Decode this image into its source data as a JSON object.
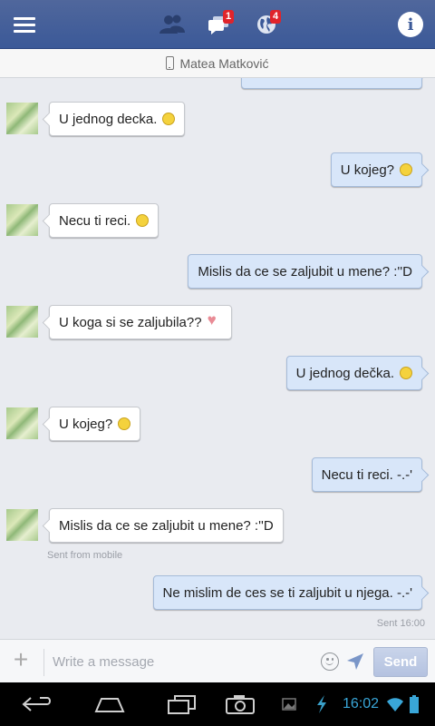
{
  "header": {
    "messages_badge": "1",
    "notifications_badge": "4"
  },
  "contact": {
    "name": "Matea Matković"
  },
  "conversation": [
    {
      "side": "in",
      "text": "U jednog decka.",
      "emoji": "smile"
    },
    {
      "side": "out",
      "text": "U kojeg?",
      "emoji": "grin"
    },
    {
      "side": "in",
      "text": "Necu ti reci.",
      "emoji": "unamused"
    },
    {
      "side": "out",
      "text": "Mislis da ce se zaljubit u mene? :''D",
      "emoji": ""
    },
    {
      "side": "in",
      "text": "U koga si se zaljubila??",
      "emoji": "heart"
    },
    {
      "side": "out",
      "text": "U jednog dečka.",
      "emoji": "wink"
    },
    {
      "side": "in",
      "text": "U kojeg?",
      "emoji": "smile"
    },
    {
      "side": "out",
      "text": "Necu ti reci. -.-'",
      "emoji": ""
    },
    {
      "side": "in",
      "text": "Mislis da ce se zaljubit u mene? :''D",
      "emoji": ""
    },
    {
      "side": "out",
      "text": "Ne mislim de ces se ti zaljubit u njega. -.-'",
      "emoji": ""
    }
  ],
  "meta": {
    "sent_from_mobile": "Sent from mobile",
    "sent_time": "Sent 16:00"
  },
  "composer": {
    "placeholder": "Write a message",
    "value": "",
    "send_label": "Send"
  },
  "system": {
    "clock": "16:02"
  },
  "colors": {
    "brand": "#3b5998",
    "outgoing_bubble": "#d8e6f9",
    "incoming_bubble": "#ffffff",
    "badge": "#e0242b",
    "clock": "#39a6d8"
  }
}
